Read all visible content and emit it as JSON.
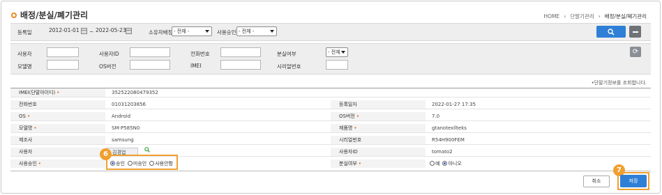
{
  "header": {
    "title": "배정/분실/폐기관리",
    "breadcrumb": [
      "HOME",
      "단말기관리",
      "배정/분실/폐기관리"
    ]
  },
  "search": {
    "reg_date_label": "등록일",
    "date_from": "2012-01-01",
    "date_sep": "~",
    "date_to": "2022-05-23",
    "owner_assign_label": "소유자배정",
    "owner_assign_value": "- 전체 -",
    "use_approval_label": "사용승인",
    "use_approval_value": "- 전체 -",
    "user_label": "사용자",
    "user_id_label": "사용자ID",
    "phone_label": "전화번호",
    "lost_label": "분실여부",
    "lost_value": "- 전체 -",
    "model_label": "모델명",
    "os_version_label": "OS버전",
    "imei_label": "IMEI",
    "serial_label": "시리얼번호"
  },
  "hint": "•단말기정보를 조회합니다.",
  "detail": {
    "imei_label": "IMEI(단말아이디)",
    "imei_value": "352522080479352",
    "phone_label": "전화번호",
    "phone_value": "01031203856",
    "reg_date_label": "등록일자",
    "reg_date_value": "2022-01-27 17:35",
    "os_label": "OS",
    "os_value": "Android",
    "os_version_label": "OS버전",
    "os_version_value": "7.0",
    "model_label": "모델명",
    "model_value": "SM-P585N0",
    "product_label": "제품명",
    "product_value": "gtanotexllteks",
    "maker_label": "제조사",
    "maker_value": "samsung",
    "serial_label": "시리얼번호",
    "serial_value": "R54H900FEM",
    "user_label": "사용자",
    "user_value": "김경업",
    "user_id_label": "사용자ID",
    "user_id_value": "tomato2",
    "approval_label": "사용승인",
    "approval_options": [
      "승인",
      "미승인",
      "사용안함"
    ],
    "lost_label": "분실여부",
    "lost_options": [
      "예",
      "아니오"
    ],
    "required_mark": "•"
  },
  "annotations": {
    "badge_6": "6",
    "badge_7": "7"
  },
  "buttons": {
    "cancel": "취소",
    "save": "저장"
  },
  "colors": {
    "accent": "#f0a030",
    "primary": "#2f7fd6",
    "required": "#e05a1a"
  }
}
